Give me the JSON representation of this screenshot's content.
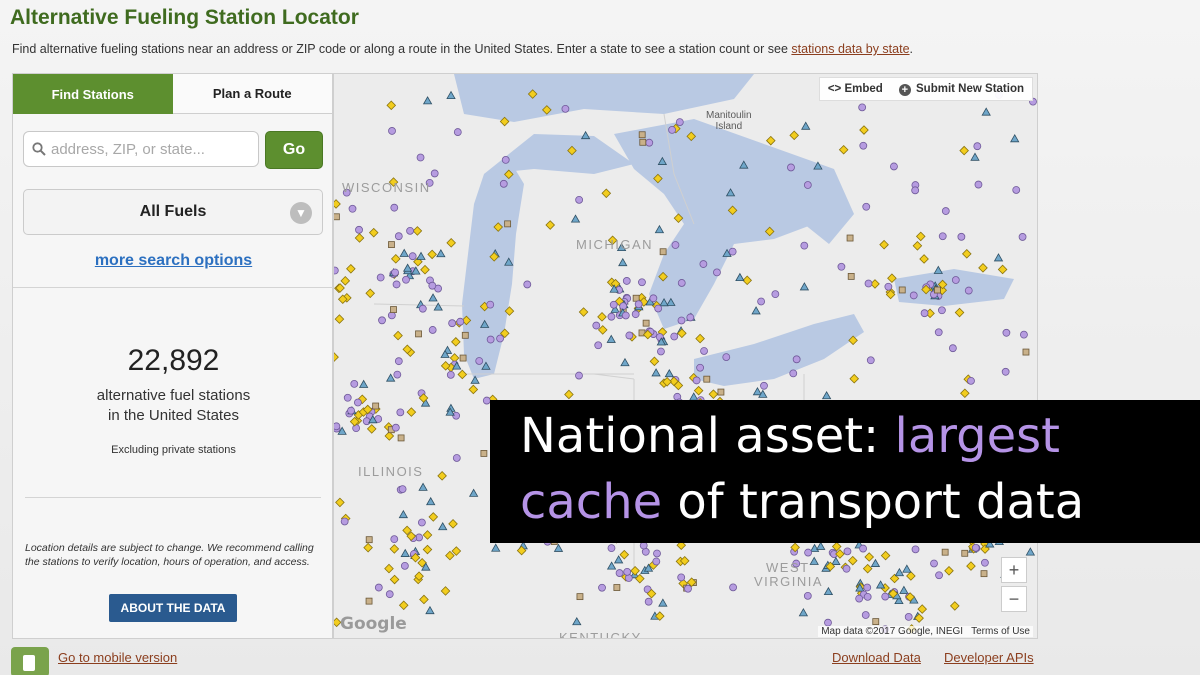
{
  "header": {
    "title": "Alternative Fueling Station Locator",
    "intro": "Find alternative fueling stations near an address or ZIP code or along a route in the United States. Enter a state to see a station count or see ",
    "intro_link": "stations data by state",
    "intro_end": "."
  },
  "panel": {
    "tabs": [
      {
        "label": "Find Stations",
        "active": true
      },
      {
        "label": "Plan a Route",
        "active": false
      }
    ],
    "search": {
      "placeholder": "address, ZIP, or state...",
      "value": "",
      "icon": "search-icon"
    },
    "go_label": "Go",
    "fuel_select": "All Fuels",
    "more_options": "more search options",
    "count": "22,892",
    "count_label_1": "alternative fuel stations",
    "count_label_2": "in the United States",
    "excluding": "Excluding private stations",
    "disclaimer": "Location details are subject to change. We recommend calling the stations to verify location, hours of operation, and access.",
    "about_button": "ABOUT THE DATA"
  },
  "map": {
    "embed": "<> Embed",
    "submit": "Submit New Station",
    "zoom_in": "+",
    "zoom_out": "−",
    "attribution": "Map data ©2017 Google, INEGI",
    "terms": "Terms of Use",
    "google": "Google",
    "labels": {
      "wisconsin": "WISCONSIN",
      "michigan": "MICHIGAN",
      "illinois": "ILLINOIS",
      "west_virginia_1": "WEST",
      "west_virginia_2": "VIRGINIA",
      "kentucky": "KENTUCKY",
      "manitoulin_1": "Manitoulin",
      "manitoulin_2": "Island"
    },
    "colors": {
      "land": "#ececec",
      "water": "#b9c9e3",
      "purple": "#b69ce0",
      "yellow": "#f2cd1e",
      "triangle": "#6fa6c9",
      "square": "#c9b18a"
    }
  },
  "footer": {
    "mobile": "Go to mobile version",
    "download_data": "Download Data",
    "developer": "Developer APIs"
  },
  "banner": {
    "line1_a": "National asset: ",
    "line1_b": "largest",
    "line2_a": "cache",
    "line2_b": " of transport data",
    "highlight_color": "#b593e6"
  }
}
